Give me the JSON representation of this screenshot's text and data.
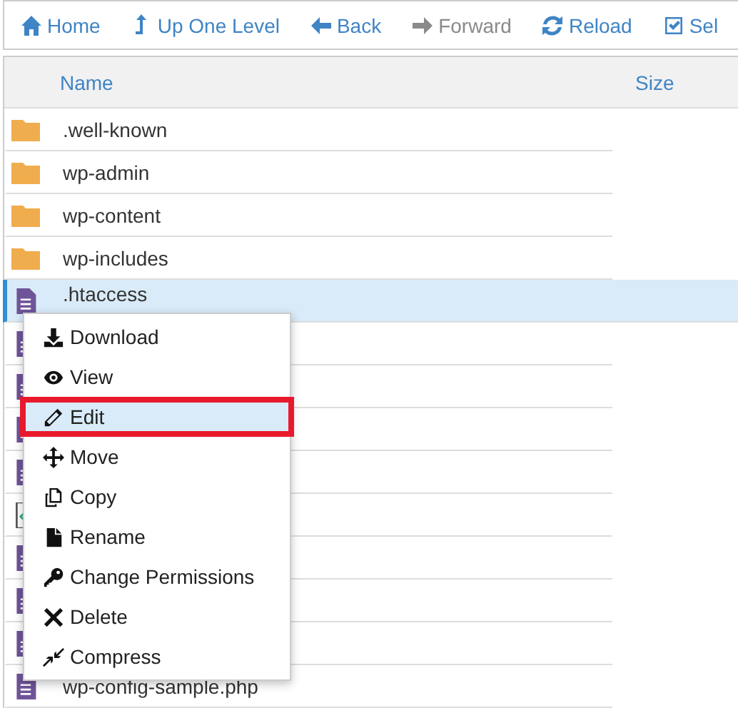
{
  "toolbar": [
    {
      "label": "Home",
      "disabled": false
    },
    {
      "label": "Up One Level",
      "disabled": false
    },
    {
      "label": "Back",
      "disabled": false
    },
    {
      "label": "Forward",
      "disabled": true
    },
    {
      "label": "Reload",
      "disabled": false
    },
    {
      "label": "Sel",
      "disabled": false
    }
  ],
  "table": {
    "columns": [
      "Name",
      "Size"
    ],
    "rows": [
      {
        "name": ".well-known",
        "kind": "folder",
        "selected": false
      },
      {
        "name": "wp-admin",
        "kind": "folder",
        "selected": false
      },
      {
        "name": "wp-content",
        "kind": "folder",
        "selected": false
      },
      {
        "name": "wp-includes",
        "kind": "folder",
        "selected": false
      },
      {
        "name": ".htaccess",
        "kind": "file",
        "selected": true
      },
      {
        "kind": "file",
        "selected": false
      },
      {
        "kind": "file",
        "selected": false
      },
      {
        "kind": "file",
        "selected": false
      },
      {
        "kind": "file",
        "selected": false
      },
      {
        "kind": "code",
        "selected": false
      },
      {
        "kind": "file",
        "selected": false
      },
      {
        "kind": "file",
        "selected": false
      },
      {
        "kind": "file",
        "selected": false
      },
      {
        "name": "wp-config-sample.php",
        "kind": "file",
        "selected": false
      }
    ]
  },
  "context_menu": [
    {
      "label": "Download",
      "selected": false
    },
    {
      "label": "View",
      "selected": false
    },
    {
      "label": "Edit",
      "selected": true
    },
    {
      "label": "Move",
      "selected": false
    },
    {
      "label": "Copy",
      "selected": false
    },
    {
      "label": "Rename",
      "selected": false
    },
    {
      "label": "Change Permissions",
      "selected": false
    },
    {
      "label": "Delete",
      "selected": false
    },
    {
      "label": "Compress",
      "selected": false
    }
  ]
}
